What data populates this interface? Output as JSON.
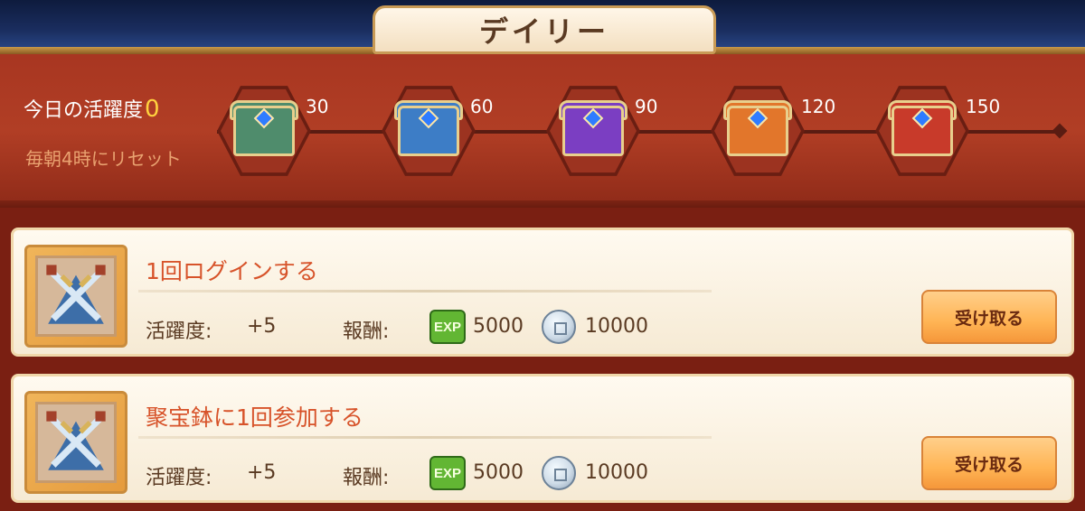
{
  "header": {
    "title": "デイリー"
  },
  "activity": {
    "today_label": "今日の活躍度",
    "today_value": "0",
    "reset_text": "毎朝4時にリセット",
    "chests": [
      {
        "value": "30",
        "color": "#4f8c6c"
      },
      {
        "value": "60",
        "color": "#3d7dc6"
      },
      {
        "value": "90",
        "color": "#7b3ec2"
      },
      {
        "value": "120",
        "color": "#e2762b"
      },
      {
        "value": "150",
        "color": "#c83a2a"
      }
    ]
  },
  "tasks": [
    {
      "title": "1回ログインする",
      "activity_label": "活躍度:",
      "activity_value": "+5",
      "reward_label": "報酬:",
      "exp_badge": "EXP",
      "exp_value": "5000",
      "coin_value": "10000",
      "button_label": "受け取る"
    },
    {
      "title": "聚宝鉢に1回参加する",
      "activity_label": "活躍度:",
      "activity_value": "+5",
      "reward_label": "報酬:",
      "exp_badge": "EXP",
      "exp_value": "5000",
      "coin_value": "10000",
      "button_label": "受け取る"
    }
  ]
}
